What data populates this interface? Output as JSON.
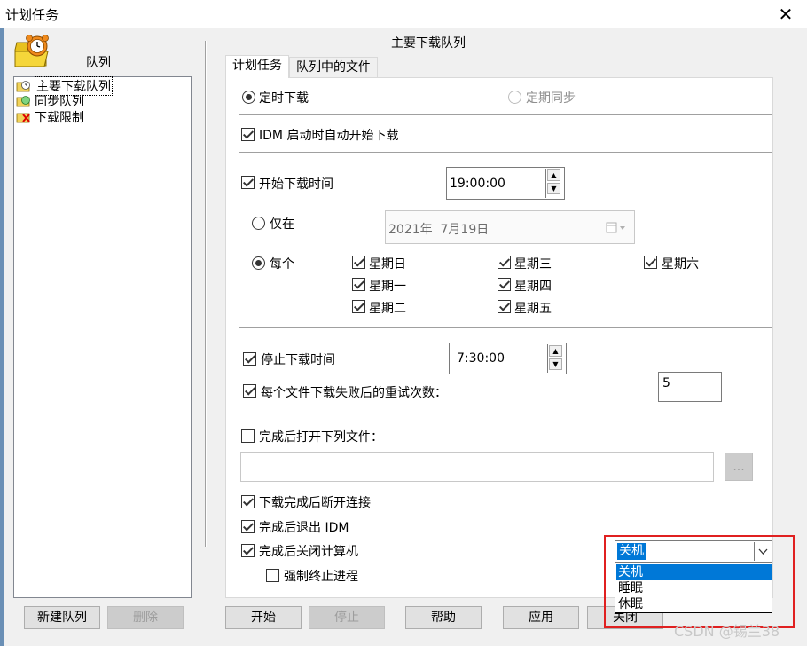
{
  "window": {
    "title": "计划任务",
    "close_glyph": "✕"
  },
  "queue_panel": {
    "header": "队列",
    "items": [
      {
        "label": "主要下载队列",
        "icon": "main-queue-icon",
        "selected": true
      },
      {
        "label": "同步队列",
        "icon": "sync-queue-icon"
      },
      {
        "label": "下载限制",
        "icon": "download-limit-icon"
      }
    ],
    "new_queue_button": "新建队列",
    "delete_button": "删除"
  },
  "right_header": "主要下载队列",
  "tabs": [
    {
      "label": "计划任务",
      "active": true
    },
    {
      "label": "队列中的文件",
      "active": false
    }
  ],
  "schedule": {
    "mode_timed": "定时下载",
    "mode_sync": "定期同步",
    "auto_start_label": "IDM 启动时自动开始下载",
    "start_time_label": "开始下载时间",
    "start_time_value": "19:00:00",
    "once_label": "仅在",
    "once_date": "2021年  7月19日",
    "daily_label": "每个",
    "days": {
      "sun": "星期日",
      "mon": "星期一",
      "tue": "星期二",
      "wed": "星期三",
      "thu": "星期四",
      "fri": "星期五",
      "sat": "星期六"
    },
    "stop_time_label": "停止下载时间",
    "stop_time_value": "7:30:00",
    "retry_label": "每个文件下载失败后的重试次数：",
    "retry_value": "5",
    "open_file_label": "完成后打开下列文件：",
    "open_file_path": "",
    "browse_button": "...",
    "disconnect_label": "下载完成后断开连接",
    "exit_idm_label": "完成后退出 IDM",
    "shutdown_label": "完成后关闭计算机",
    "force_kill_label": "强制终止进程",
    "shutdown_select": {
      "value": "关机",
      "options": [
        "关机",
        "睡眠",
        "休眠"
      ]
    }
  },
  "bottom_buttons": {
    "start": "开始",
    "stop": "停止",
    "help": "帮助",
    "apply": "应用",
    "close": "关闭"
  },
  "watermark": "CSDN @锡兰38",
  "colors": {
    "highlight": "#0078d7",
    "annotation_red": "#e02020"
  }
}
